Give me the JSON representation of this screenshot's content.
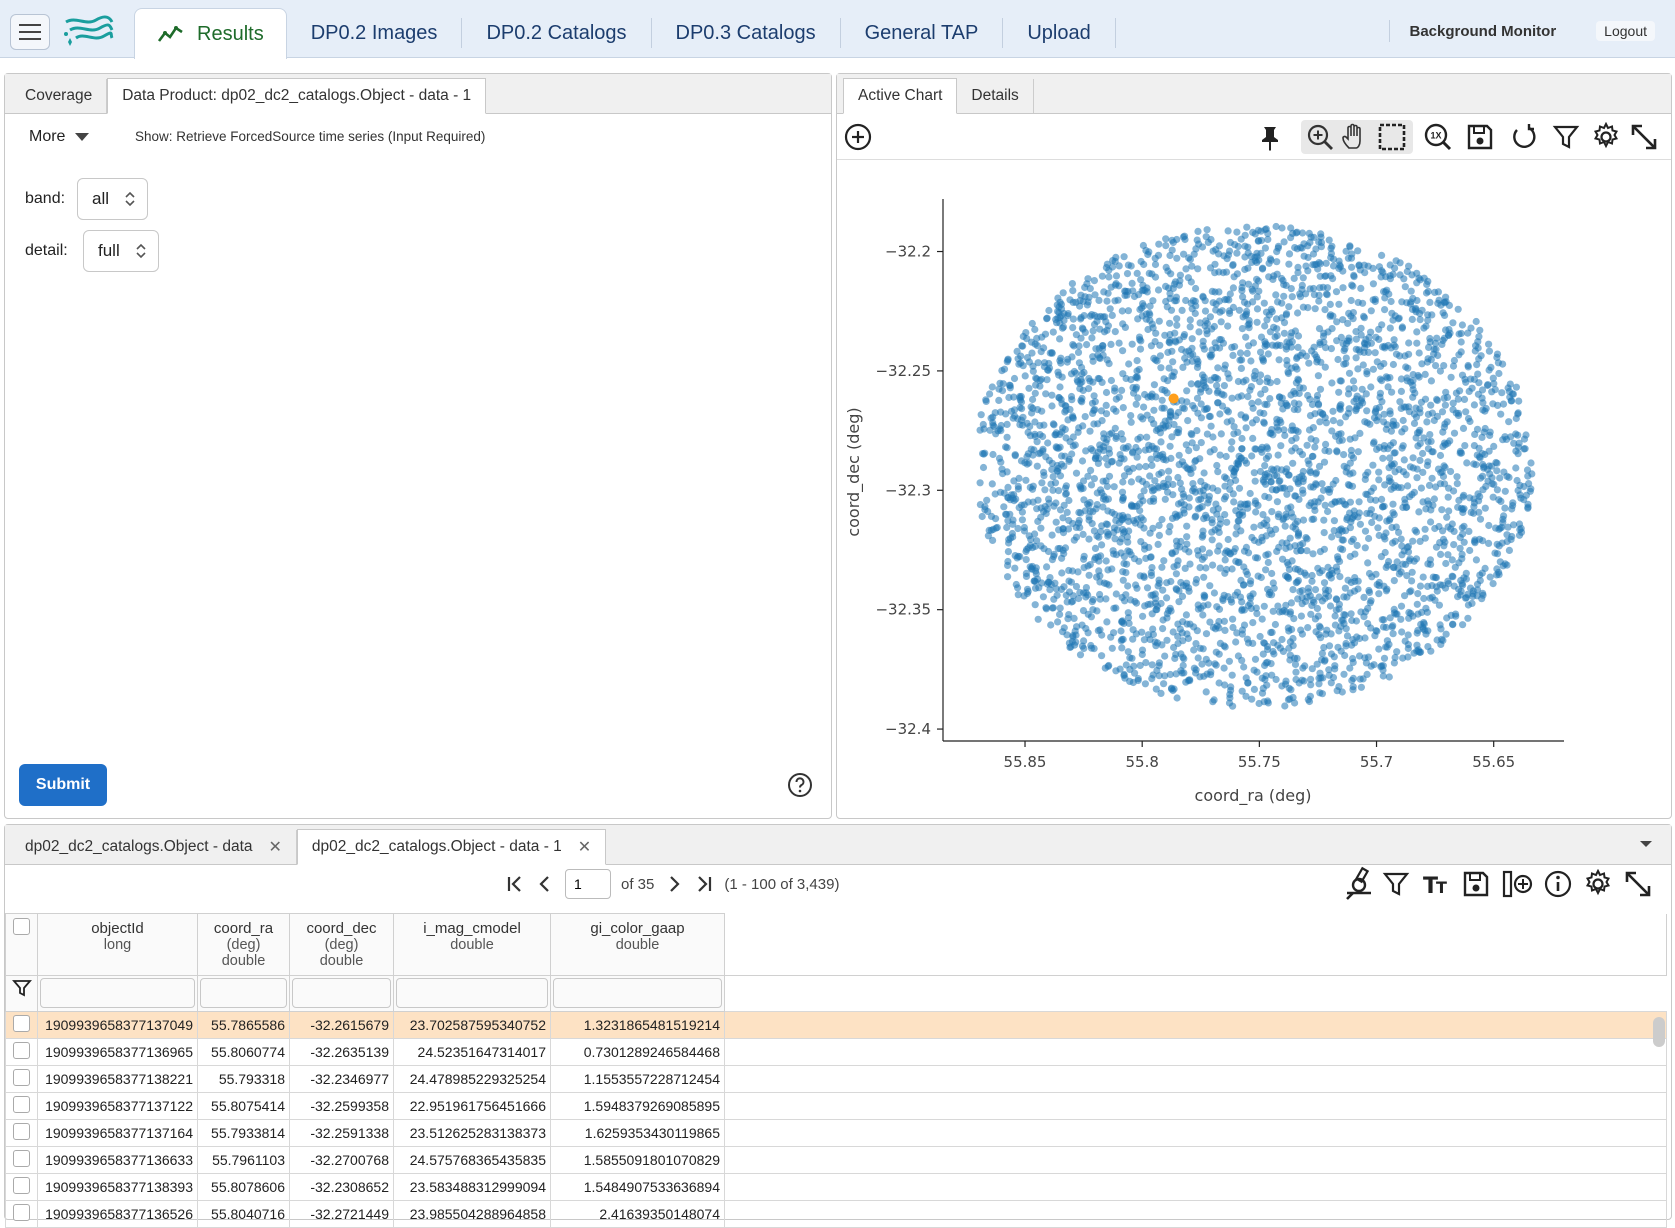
{
  "topbar": {
    "tabs": [
      {
        "label": "Results"
      },
      {
        "label": "DP0.2 Images"
      },
      {
        "label": "DP0.2 Catalogs"
      },
      {
        "label": "DP0.3 Catalogs"
      },
      {
        "label": "General TAP"
      },
      {
        "label": "Upload"
      }
    ],
    "background_monitor": "Background Monitor",
    "logout": "Logout"
  },
  "left_panel": {
    "tabs": [
      "Coverage",
      "Data Product: dp02_dc2_catalogs.Object - data - 1"
    ],
    "more_label": "More",
    "show_text": "Show: Retrieve ForcedSource time series (Input Required)",
    "band_label": "band:",
    "band_value": "all",
    "detail_label": "detail:",
    "detail_value": "full",
    "submit_label": "Submit"
  },
  "right_panel": {
    "tabs": [
      "Active Chart",
      "Details"
    ]
  },
  "chart_data": {
    "type": "scatter",
    "xlabel": "coord_ra (deg)",
    "ylabel": "coord_dec (deg)",
    "xlim": [
      55.885,
      55.62
    ],
    "ylim": [
      -32.405,
      -32.178
    ],
    "x_ticks": [
      "55.85",
      "55.8",
      "55.75",
      "55.7",
      "55.65"
    ],
    "y_ticks": [
      "−32.2",
      "−32.25",
      "−32.3",
      "−32.35",
      "−32.4"
    ],
    "series": [
      {
        "color": "#1f77b4",
        "center": [
          55.7525,
          -32.29
        ],
        "radius_ra": 0.119,
        "radius_dec": 0.101,
        "count": 3439
      },
      {
        "color": "#ff9f1c",
        "points": [
          [
            55.7865586,
            -32.2615679
          ]
        ]
      }
    ]
  },
  "bottom_panel": {
    "tabs": [
      {
        "label": "dp02_dc2_catalogs.Object - data"
      },
      {
        "label": "dp02_dc2_catalogs.Object - data - 1"
      }
    ],
    "page_value": "1",
    "page_of": "of 35",
    "range_text": "(1 - 100 of 3,439)",
    "columns": [
      {
        "name": "objectId",
        "unit": "",
        "type": "long"
      },
      {
        "name": "coord_ra",
        "unit": "(deg)",
        "type": "double"
      },
      {
        "name": "coord_dec",
        "unit": "(deg)",
        "type": "double"
      },
      {
        "name": "i_mag_cmodel",
        "unit": "",
        "type": "double"
      },
      {
        "name": "gi_color_gaap",
        "unit": "",
        "type": "double"
      }
    ],
    "rows": [
      [
        "1909939658377137049",
        "55.7865586",
        "-32.2615679",
        "23.702587595340752",
        "1.3231865481519214"
      ],
      [
        "1909939658377136965",
        "55.8060774",
        "-32.2635139",
        "24.52351647314017",
        "0.7301289246584468"
      ],
      [
        "1909939658377138221",
        "55.793318",
        "-32.2346977",
        "24.478985229325254",
        "1.1553557228712454"
      ],
      [
        "1909939658377137122",
        "55.8075414",
        "-32.2599358",
        "22.951961756451666",
        "1.5948379269085895"
      ],
      [
        "1909939658377137164",
        "55.7933814",
        "-32.2591338",
        "23.512625283138373",
        "1.6259353430119865"
      ],
      [
        "1909939658377136633",
        "55.7961103",
        "-32.2700768",
        "24.575768365435835",
        "1.5855091801070829"
      ],
      [
        "1909939658377138393",
        "55.8078606",
        "-32.2308652",
        "23.583488312999094",
        "1.5484907533636894"
      ],
      [
        "1909939658377136526",
        "55.8040716",
        "-32.2721449",
        "23.985504288964858",
        "2.41639350148074"
      ]
    ]
  }
}
